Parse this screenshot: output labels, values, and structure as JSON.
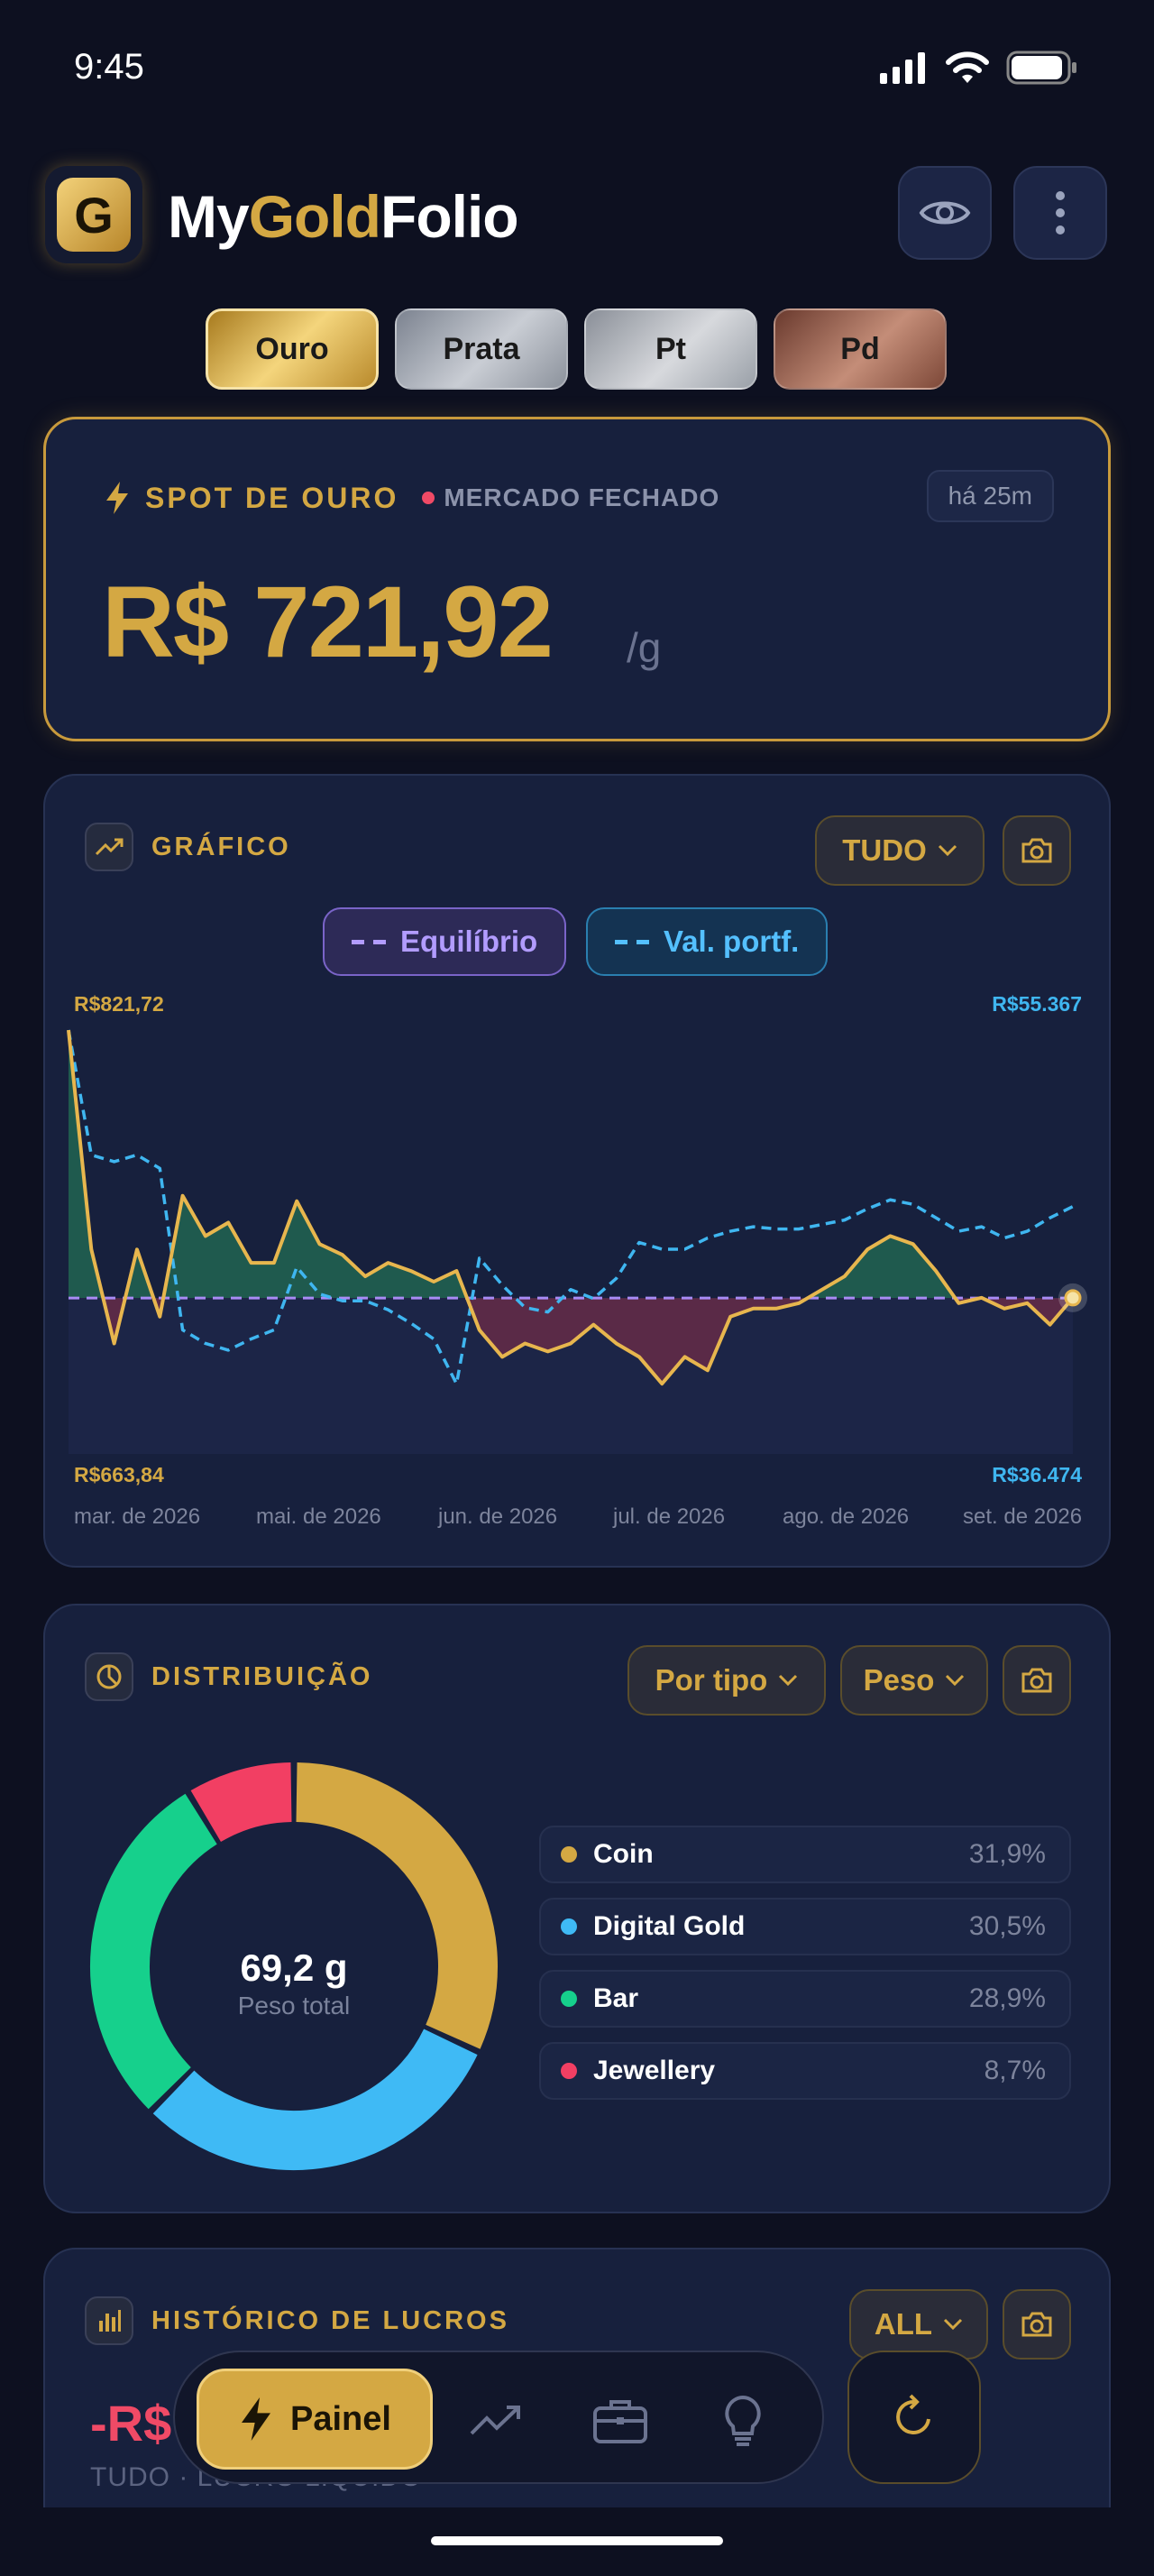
{
  "status": {
    "time": "9:45"
  },
  "header": {
    "logo_letter": "G",
    "title_my": "My",
    "title_gold": "Gold",
    "title_folio": "Folio",
    "eye_icon": "eye-icon",
    "menu_icon": "more-vertical-icon"
  },
  "metal_tabs": [
    {
      "label": "Ouro",
      "active": true
    },
    {
      "label": "Prata",
      "active": false
    },
    {
      "label": "Pt",
      "active": false
    },
    {
      "label": "Pd",
      "active": false
    }
  ],
  "spot": {
    "label": "SPOT DE OURO",
    "market_status": "MERCADO FECHADO",
    "updated": "há 25m",
    "price": "R$ 721,92",
    "unit": "/g"
  },
  "chart": {
    "title": "GRÁFICO",
    "range": "TUDO",
    "legend_breakeven": "Equilíbrio",
    "legend_portfolio": "Val. portf.",
    "left_max": "R$821,72",
    "left_min": "R$663,84",
    "right_max": "R$55.367",
    "right_min": "R$36.474",
    "colors": {
      "price": "#e7b64e",
      "portfolio": "#3fb6f0",
      "breakeven": "#a98bf5",
      "gain": "#1f5a4e",
      "loss": "#5a2a47"
    }
  },
  "chart_data": {
    "type": "line",
    "x_labels": [
      "mar. de 2026",
      "mai. de 2026",
      "jun. de 2026",
      "jul. de 2026",
      "ago. de 2026",
      "set. de 2026"
    ],
    "series": [
      {
        "name": "",
        "axis": "left",
        "values": [
          821.7,
          740,
          705,
          740,
          715,
          760,
          745,
          750,
          735,
          735,
          758,
          742,
          738,
          730,
          735,
          732,
          728,
          732,
          710,
          700,
          705,
          702,
          705,
          712,
          705,
          700,
          690,
          700,
          695,
          715,
          718,
          718,
          720,
          725,
          730,
          740,
          745,
          742,
          732,
          720,
          722,
          718,
          720,
          712,
          722
        ]
      },
      {
        "name": "Val. portf.",
        "axis": "right",
        "values": [
          55367,
          49800,
          49500,
          49800,
          49200,
          42000,
          41400,
          41100,
          41600,
          42000,
          44800,
          43600,
          43300,
          43300,
          42900,
          42300,
          41600,
          39600,
          45200,
          44000,
          43000,
          42800,
          43800,
          43400,
          44300,
          45900,
          45600,
          45600,
          46100,
          46400,
          46600,
          46500,
          46500,
          46700,
          46900,
          47400,
          47800,
          47600,
          47000,
          46400,
          46600,
          46100,
          46400,
          47000,
          47500
        ]
      },
      {
        "name": "Equilíbrio",
        "axis": "left",
        "values": [
          721.92,
          721.92
        ]
      }
    ],
    "ylim_left": [
      663.84,
      821.72
    ],
    "ylim_right": [
      36474,
      55367
    ]
  },
  "distribution": {
    "title": "DISTRIBUIÇÃO",
    "group_by": "Por tipo",
    "metric": "Peso",
    "center_value": "69,2 g",
    "center_label": "Peso total",
    "items": [
      {
        "name": "Coin",
        "pct": "31,9%",
        "value": 31.9,
        "color": "#d4a843"
      },
      {
        "name": "Digital Gold",
        "pct": "30,5%",
        "value": 30.5,
        "color": "#3fbaf5"
      },
      {
        "name": "Bar",
        "pct": "28,9%",
        "value": 28.9,
        "color": "#16d08c"
      },
      {
        "name": "Jewellery",
        "pct": "8,7%",
        "value": 8.7,
        "color": "#f23f63"
      }
    ]
  },
  "profit": {
    "title": "HISTÓRICO DE LUCROS",
    "range": "ALL",
    "value_partial": "-R$",
    "subtitle": "TUDO · LUCRO LÍQUIDO"
  },
  "nav": {
    "active_label": "Painel",
    "items": [
      "chart-icon",
      "briefcase-icon",
      "lightbulb-icon"
    ],
    "refresh_icon": "refresh-icon"
  }
}
